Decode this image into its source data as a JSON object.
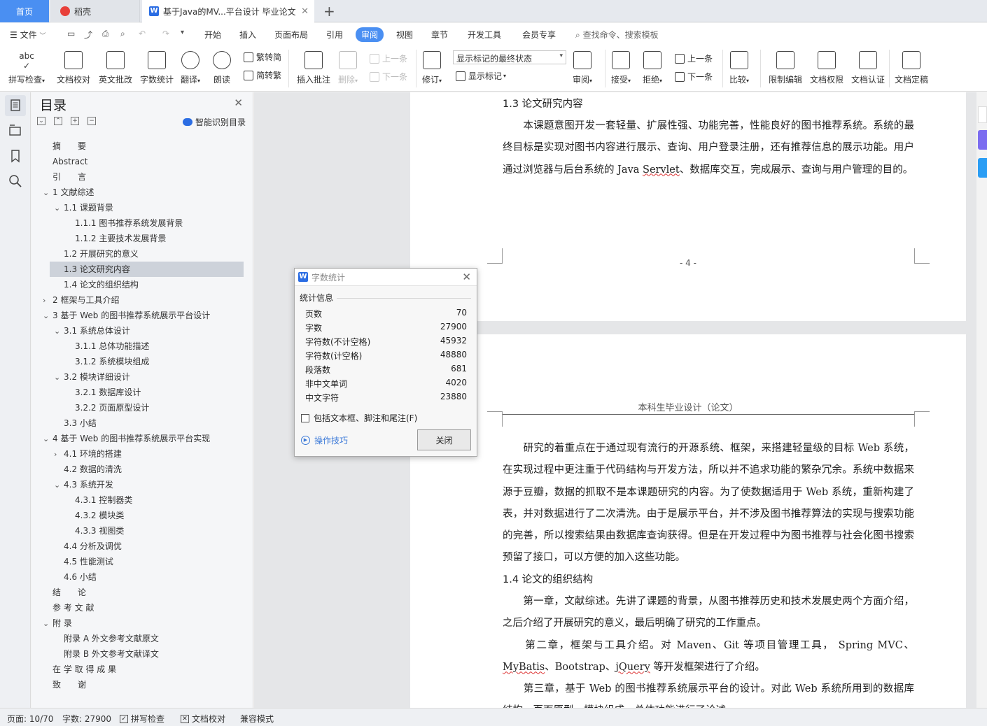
{
  "tabs": {
    "home": "首页",
    "daoke": "稻壳",
    "doc": "基于Java的MV...平台设计 毕业论文"
  },
  "menu": {
    "file": "文件",
    "items": [
      "开始",
      "插入",
      "页面布局",
      "引用",
      "审阅",
      "视图",
      "章节",
      "开发工具",
      "会员专享"
    ],
    "search_placeholder": "查找命令、搜索模板"
  },
  "ribbon": {
    "spellcheck": "拼写检查",
    "doc_proof": "文档校对",
    "eng_grade": "英文批改",
    "word_count": "字数统计",
    "translate": "翻译",
    "read_aloud": "朗读",
    "to_traditional": "繁转简",
    "to_simplified": "简转繁",
    "insert_comment": "插入批注",
    "delete": "删除",
    "prev_comment": "上一条",
    "next_comment": "下一条",
    "track": "修订",
    "markup_state": "显示标记的最终状态",
    "show_markup": "显示标记",
    "review": "审阅",
    "accept": "接受",
    "reject": "拒绝",
    "prev_change": "上一条",
    "next_change": "下一条",
    "compare": "比较",
    "restrict": "限制编辑",
    "permission": "文档权限",
    "certify": "文档认证",
    "finalize": "文档定稿"
  },
  "toc": {
    "title": "目录",
    "smart_label": "智能识别目录",
    "items": [
      {
        "text": "摘　　要",
        "level": 0,
        "chev": ""
      },
      {
        "text": "Abstract",
        "level": 0,
        "chev": ""
      },
      {
        "text": "引　　言",
        "level": 0,
        "chev": ""
      },
      {
        "text": "1  文献综述",
        "level": 0,
        "chev": "v"
      },
      {
        "text": "1.1  课题背景",
        "level": 1,
        "chev": "v"
      },
      {
        "text": "1.1.1  图书推荐系统发展背景",
        "level": 2,
        "chev": ""
      },
      {
        "text": "1.1.2  主要技术发展背景",
        "level": 2,
        "chev": ""
      },
      {
        "text": "1.2  开展研究的意义",
        "level": 1,
        "chev": ""
      },
      {
        "text": "1.3  论文研究内容",
        "level": 1,
        "chev": "",
        "selected": true
      },
      {
        "text": "1.4  论文的组织结构",
        "level": 1,
        "chev": ""
      },
      {
        "text": "2  框架与工具介绍",
        "level": 0,
        "chev": ">"
      },
      {
        "text": "3  基于 Web 的图书推荐系统展示平台设计",
        "level": 0,
        "chev": "v"
      },
      {
        "text": "3.1  系统总体设计",
        "level": 1,
        "chev": "v"
      },
      {
        "text": "3.1.1  总体功能描述",
        "level": 2,
        "chev": ""
      },
      {
        "text": "3.1.2  系统模块组成",
        "level": 2,
        "chev": ""
      },
      {
        "text": "3.2  模块详细设计",
        "level": 1,
        "chev": "v"
      },
      {
        "text": "3.2.1  数据库设计",
        "level": 2,
        "chev": ""
      },
      {
        "text": "3.2.2  页面原型设计",
        "level": 2,
        "chev": ""
      },
      {
        "text": "3.3  小结",
        "level": 1,
        "chev": ""
      },
      {
        "text": "4  基于 Web 的图书推荐系统展示平台实现",
        "level": 0,
        "chev": "v"
      },
      {
        "text": "4.1  环境的搭建",
        "level": 1,
        "chev": ">"
      },
      {
        "text": "4.2  数据的清洗",
        "level": 1,
        "chev": ""
      },
      {
        "text": "4.3  系统开发",
        "level": 1,
        "chev": "v"
      },
      {
        "text": "4.3.1  控制器类",
        "level": 2,
        "chev": ""
      },
      {
        "text": "4.3.2  模块类",
        "level": 2,
        "chev": ""
      },
      {
        "text": "4.3.3  视图类",
        "level": 2,
        "chev": ""
      },
      {
        "text": "4.4  分析及调优",
        "level": 1,
        "chev": ""
      },
      {
        "text": "4.5  性能测试",
        "level": 1,
        "chev": ""
      },
      {
        "text": "4.6  小结",
        "level": 1,
        "chev": ""
      },
      {
        "text": "结　　论",
        "level": 0,
        "chev": ""
      },
      {
        "text": "参 考 文 献",
        "level": 0,
        "chev": ""
      },
      {
        "text": "附  录",
        "level": 0,
        "chev": "v"
      },
      {
        "text": "附录 A  外文参考文献原文",
        "level": 1,
        "chev": ""
      },
      {
        "text": "附录 B  外文参考文献译文",
        "level": 1,
        "chev": ""
      },
      {
        "text": "在 学 取 得 成 果",
        "level": 0,
        "chev": ""
      },
      {
        "text": "致　　谢",
        "level": 0,
        "chev": ""
      }
    ]
  },
  "page1": {
    "heading": "1.3  论文研究内容",
    "para": "　　本课题意图开发一套轻量、扩展性强、功能完善，性能良好的图书推荐系统。系统的最终目标是实现对图书内容进行展示、查询、用户登录注册，还有推荐信息的展示功能。用户通过浏览器与后台系统的 Java ",
    "para_squig": "Servlet",
    "para_end": "、数据库交互，完成展示、查询与用户管理的目的。",
    "page_number": "- 4 -"
  },
  "page2": {
    "header": "本科生毕业设计（论文）",
    "para1": "　　研究的着重点在于通过现有流行的开源系统、框架，来搭建轻量级的目标 Web 系统，在实现过程中更注重于代码结构与开发方法，所以并不追求功能的繁杂冗余。系统中数据来源于豆瓣，数据的抓取不是本课题研究的内容。为了使数据适用于 Web 系统，重新构建了表，并对数据进行了二次清洗。由于是展示平台，并不涉及图书推荐算法的实现与搜索功能的完善，所以搜索结果由数据库查询获得。但是在开发过程中为图书推荐与社会化图书搜索预留了接口，可以方便的加入这些功能。",
    "heading": "1.4  论文的组织结构",
    "para2": "　　第一章，文献综述。先讲了课题的背景，从图书推荐历史和技术发展史两个方面介绍，之后介绍了开展研究的意义，最后明确了研究的工作重点。",
    "para3_a": "　　第二章，框架与工具介绍。对 Maven、Git 等项目管理工具， Spring MVC、",
    "para3_sq1": "MyBatis",
    "para3_b": "、Bootstrap、",
    "para3_sq2": "jQuery",
    "para3_c": " 等开发框架进行了介绍。",
    "para4": "　　第三章，基于 Web 的图书推荐系统展示平台的设计。对此 Web 系统所用到的数据库结构、页面原型、模块组成、总体功能进行了论述。"
  },
  "dialog": {
    "title": "字数统计",
    "section": "统计信息",
    "rows": [
      {
        "label": "页数",
        "value": "70"
      },
      {
        "label": "字数",
        "value": "27900"
      },
      {
        "label": "字符数(不计空格)",
        "value": "45932"
      },
      {
        "label": "字符数(计空格)",
        "value": "48880"
      },
      {
        "label": "段落数",
        "value": "681"
      },
      {
        "label": "非中文单词",
        "value": "4020"
      },
      {
        "label": "中文字符",
        "value": "23880"
      }
    ],
    "checkbox_label": "包括文本框、脚注和尾注(F)",
    "tips": "操作技巧",
    "close": "关闭"
  },
  "status": {
    "page": "页面: 10/70",
    "words": "字数: 27900",
    "spellcheck": "拼写检查",
    "proof": "文档校对",
    "compat": "兼容模式"
  }
}
